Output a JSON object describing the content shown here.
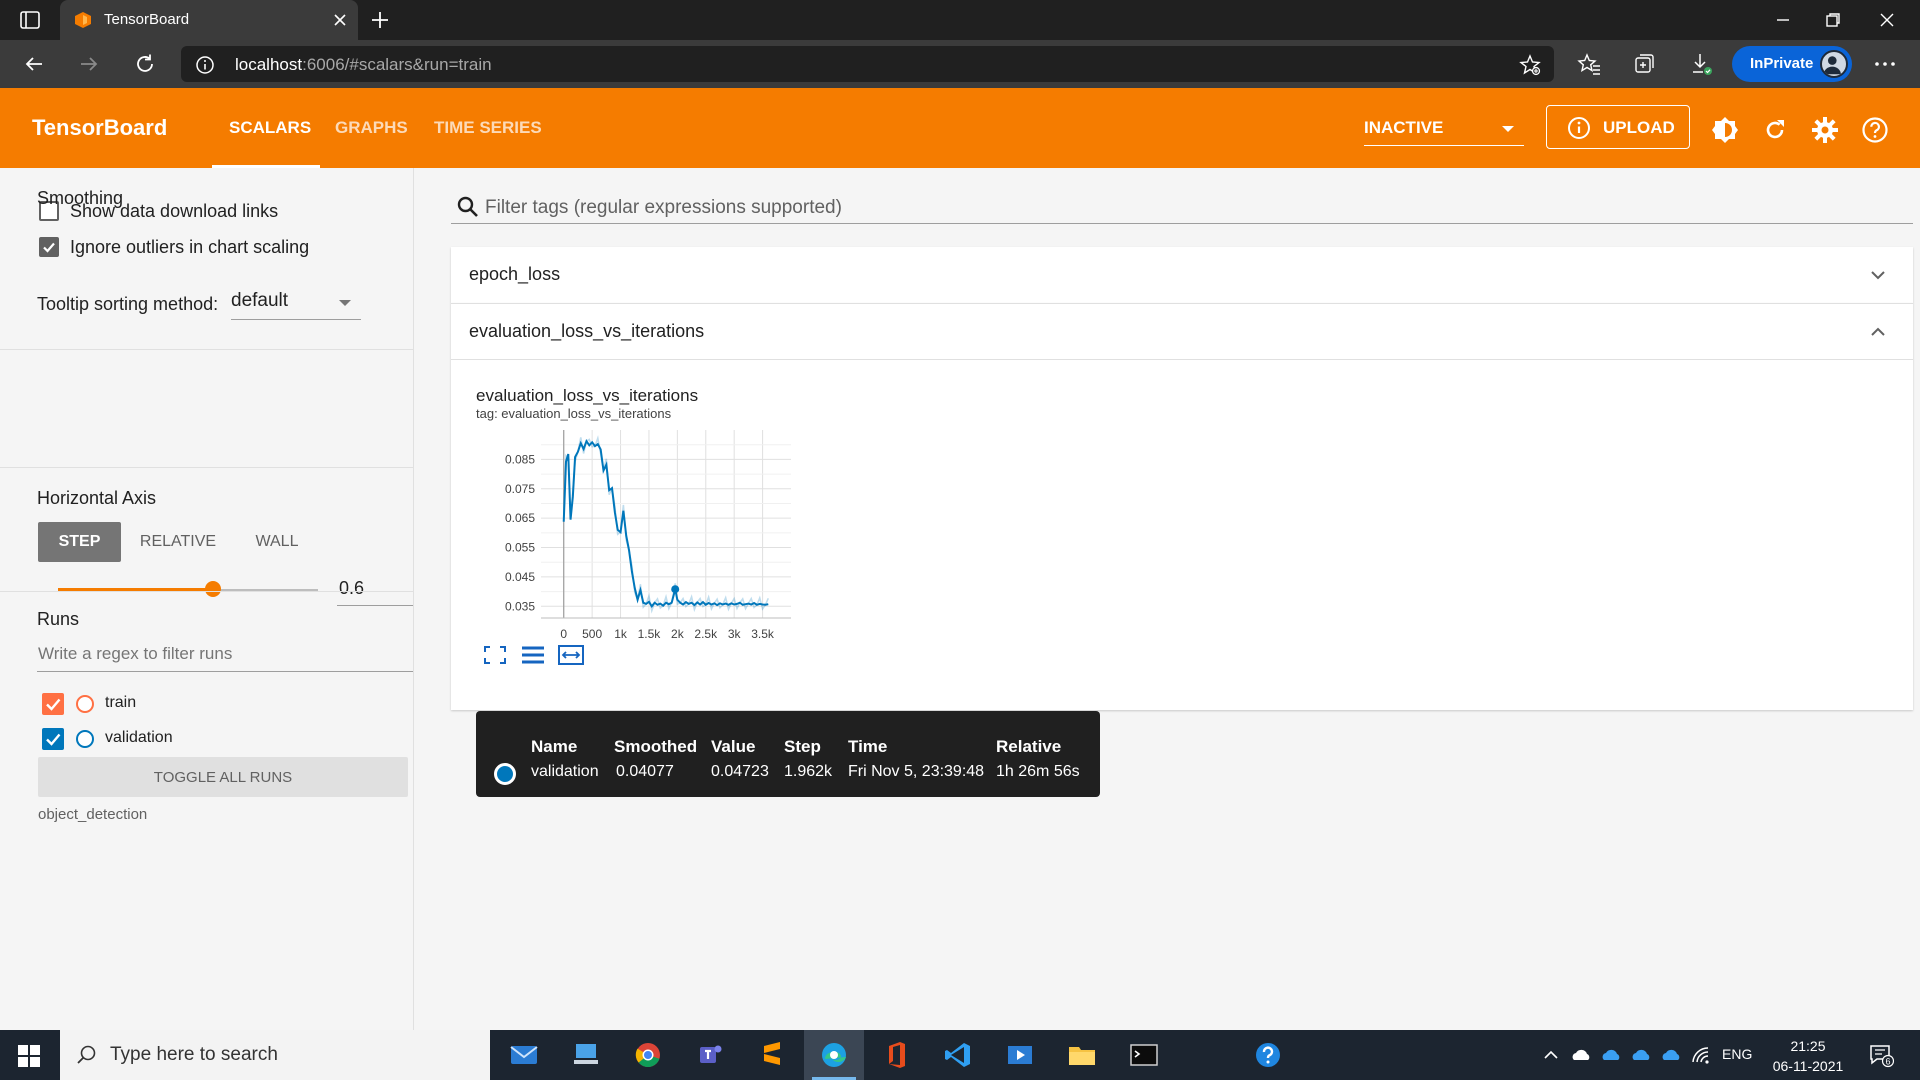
{
  "browser": {
    "tab_title": "TensorBoard",
    "url_host": "localhost",
    "url_rest": ":6006/#scalars&run=train",
    "inprivate_label": "InPrivate"
  },
  "header": {
    "logo": "TensorBoard",
    "tabs": [
      {
        "label": "SCALARS",
        "active": true
      },
      {
        "label": "GRAPHS",
        "active": false
      },
      {
        "label": "TIME SERIES",
        "active": false
      }
    ],
    "select_value": "INACTIVE",
    "upload_label": "UPLOAD",
    "accent_color": "#f57c00"
  },
  "sidebar": {
    "show_download_links": {
      "label": "Show data download links",
      "checked": false
    },
    "ignore_outliers": {
      "label": "Ignore outliers in chart scaling",
      "checked": true
    },
    "tooltip_sorting": {
      "label": "Tooltip sorting method:",
      "value": "default"
    },
    "smoothing": {
      "label": "Smoothing",
      "value": "0.6",
      "fraction": 0.6
    },
    "horizontal_axis": {
      "label": "Horizontal Axis",
      "options": [
        "STEP",
        "RELATIVE",
        "WALL"
      ],
      "selected": "STEP"
    },
    "runs": {
      "label": "Runs",
      "filter_placeholder": "Write a regex to filter runs",
      "items": [
        {
          "name": "train",
          "checked": true,
          "color": "#ff7043"
        },
        {
          "name": "validation",
          "checked": true,
          "color": "#0077bb"
        }
      ],
      "toggle_label": "TOGGLE ALL RUNS",
      "footer": "object_detection"
    }
  },
  "main": {
    "filter_placeholder": "Filter tags (regular expressions supported)",
    "cards": [
      {
        "title": "epoch_loss",
        "expanded": false
      },
      {
        "title": "evaluation_loss_vs_iterations",
        "expanded": true
      }
    ]
  },
  "chart_data": {
    "type": "line",
    "title": "evaluation_loss_vs_iterations",
    "subtitle": "tag: evaluation_loss_vs_iterations",
    "xlabel": "",
    "ylabel": "",
    "x_ticks": [
      "0",
      "500",
      "1k",
      "1.5k",
      "2k",
      "2.5k",
      "3k",
      "3.5k"
    ],
    "y_ticks": [
      "0.085",
      "0.075",
      "0.065",
      "0.055",
      "0.045",
      "0.035"
    ],
    "xlim": [
      -400,
      4000
    ],
    "ylim": [
      0.031,
      0.095
    ],
    "grid": true,
    "series": [
      {
        "name": "validation",
        "color": "#0077bb",
        "x": [
          0,
          40,
          80,
          120,
          160,
          200,
          250,
          300,
          350,
          400,
          450,
          500,
          550,
          600,
          650,
          700,
          750,
          800,
          850,
          900,
          950,
          1000,
          1050,
          1100,
          1150,
          1200,
          1250,
          1300,
          1350,
          1400,
          1450,
          1500,
          1550,
          1600,
          1650,
          1700,
          1750,
          1800,
          1850,
          1900,
          1962,
          2000,
          2050,
          2100,
          2150,
          2200,
          2250,
          2300,
          2350,
          2400,
          2450,
          2500,
          2550,
          2600,
          2650,
          2700,
          2750,
          2800,
          2850,
          2900,
          2950,
          3000,
          3050,
          3100,
          3150,
          3200,
          3250,
          3300,
          3350,
          3400,
          3450,
          3500,
          3550,
          3600
        ],
        "values": [
          0.0638,
          0.0842,
          0.0868,
          0.0645,
          0.0722,
          0.0858,
          0.0876,
          0.0905,
          0.0885,
          0.0912,
          0.0898,
          0.0908,
          0.0895,
          0.0902,
          0.0884,
          0.0812,
          0.0832,
          0.0745,
          0.0752,
          0.067,
          0.061,
          0.0602,
          0.0675,
          0.059,
          0.054,
          0.0468,
          0.0412,
          0.0372,
          0.0405,
          0.0362,
          0.0358,
          0.0365,
          0.035,
          0.0362,
          0.0355,
          0.0359,
          0.0352,
          0.0362,
          0.0357,
          0.0362,
          0.0408,
          0.0372,
          0.0362,
          0.0356,
          0.0364,
          0.0358,
          0.0362,
          0.0354,
          0.0363,
          0.0356,
          0.0364,
          0.0355,
          0.0361,
          0.0356,
          0.036,
          0.0354,
          0.036,
          0.0356,
          0.0359,
          0.0355,
          0.036,
          0.0356,
          0.0358,
          0.0362,
          0.0355,
          0.0357,
          0.0359,
          0.0356,
          0.0361,
          0.0355,
          0.0358,
          0.0356,
          0.0355,
          0.0357
        ]
      }
    ],
    "highlight": {
      "x": 1962,
      "y": 0.0408
    }
  },
  "tooltip": {
    "headers": [
      "Name",
      "Smoothed",
      "Value",
      "Step",
      "Time",
      "Relative"
    ],
    "row": [
      "validation",
      "0.04077",
      "0.04723",
      "1.962k",
      "Fri Nov 5, 23:39:48",
      "1h 26m 56s"
    ]
  },
  "taskbar": {
    "search_placeholder": "Type here to search",
    "language": "ENG",
    "time": "21:25",
    "date": "06-11-2021",
    "notification_count": "6"
  }
}
